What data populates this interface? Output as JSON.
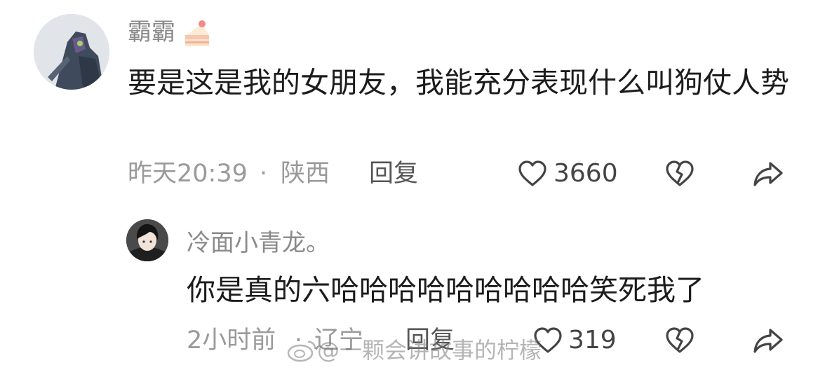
{
  "comment": {
    "username": "霸霸",
    "badge_icon": "cake-icon",
    "text": "要是这是我的女朋友，我能充分表现什么叫狗仗人势",
    "time": "昨天20:39",
    "separator": "·",
    "location": "陕西",
    "reply_label": "回复",
    "like_count": "3660"
  },
  "reply": {
    "username": "冷面小青龙。",
    "text": "你是真的六哈哈哈哈哈哈哈哈哈笑死我了",
    "time": "2小时前",
    "separator": "·",
    "location": "辽宁",
    "reply_label": "回复",
    "like_count": "319"
  },
  "watermark": {
    "text": "@一颗会讲故事的柠檬"
  },
  "colors": {
    "meta_gray": "#9a9a9a",
    "text": "#1c1c1c"
  }
}
